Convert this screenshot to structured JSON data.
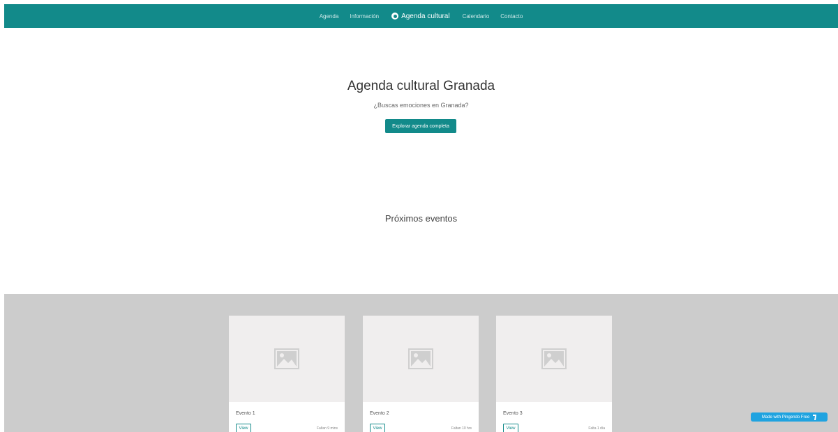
{
  "nav": {
    "links_left": [
      "Agenda",
      "Información"
    ],
    "brand": "Agenda cultural",
    "brand_icon": "target-circle-icon",
    "links_right": [
      "Calendario",
      "Contacto"
    ]
  },
  "hero": {
    "title": "Agenda cultural Granada",
    "subtitle": "¿Buscas emociones en Granada?",
    "button_label": "Explorar agenda completa"
  },
  "events": {
    "section_title": "Próximos eventos",
    "cards": [
      {
        "title": "Evento 1",
        "view_label": "View",
        "time": "Faltan 9 mins",
        "image_icon": "image-placeholder-icon"
      },
      {
        "title": "Evento 2",
        "view_label": "View",
        "time": "Faltan 10 hrs",
        "image_icon": "image-placeholder-icon"
      },
      {
        "title": "Evento 3",
        "view_label": "View",
        "time": "Falta 1 día",
        "image_icon": "image-placeholder-icon"
      }
    ]
  },
  "badge": {
    "label": "Made with Pingendo Free",
    "icon": "pingendo-logo-icon"
  },
  "colors": {
    "primary": "#128a8a",
    "band": "#cccccc",
    "badge": "#1fa3e0"
  }
}
